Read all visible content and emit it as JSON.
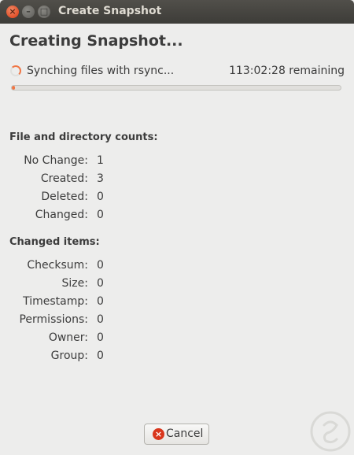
{
  "window": {
    "title": "Create Snapshot"
  },
  "heading": "Creating Snapshot...",
  "status": {
    "message": "Synching files with rsync...",
    "remaining": "113:02:28 remaining",
    "progress": 0.01
  },
  "counts": {
    "title": "File and directory counts:",
    "rows": [
      {
        "label": "No Change:",
        "value": "1"
      },
      {
        "label": "Created:",
        "value": "3"
      },
      {
        "label": "Deleted:",
        "value": "0"
      },
      {
        "label": "Changed:",
        "value": "0"
      }
    ]
  },
  "changed": {
    "title": "Changed items:",
    "rows": [
      {
        "label": "Checksum:",
        "value": "0"
      },
      {
        "label": "Size:",
        "value": "0"
      },
      {
        "label": "Timestamp:",
        "value": "0"
      },
      {
        "label": "Permissions:",
        "value": "0"
      },
      {
        "label": "Owner:",
        "value": "0"
      },
      {
        "label": "Group:",
        "value": "0"
      }
    ]
  },
  "buttons": {
    "cancel": "Cancel"
  },
  "icons": {
    "close": "close-icon",
    "minimize": "minimize-icon",
    "maximize": "maximize-icon",
    "spinner": "spinner-icon",
    "cancel": "cancel-icon"
  },
  "colors": {
    "accent": "#f07746",
    "close": "#e0502a"
  }
}
